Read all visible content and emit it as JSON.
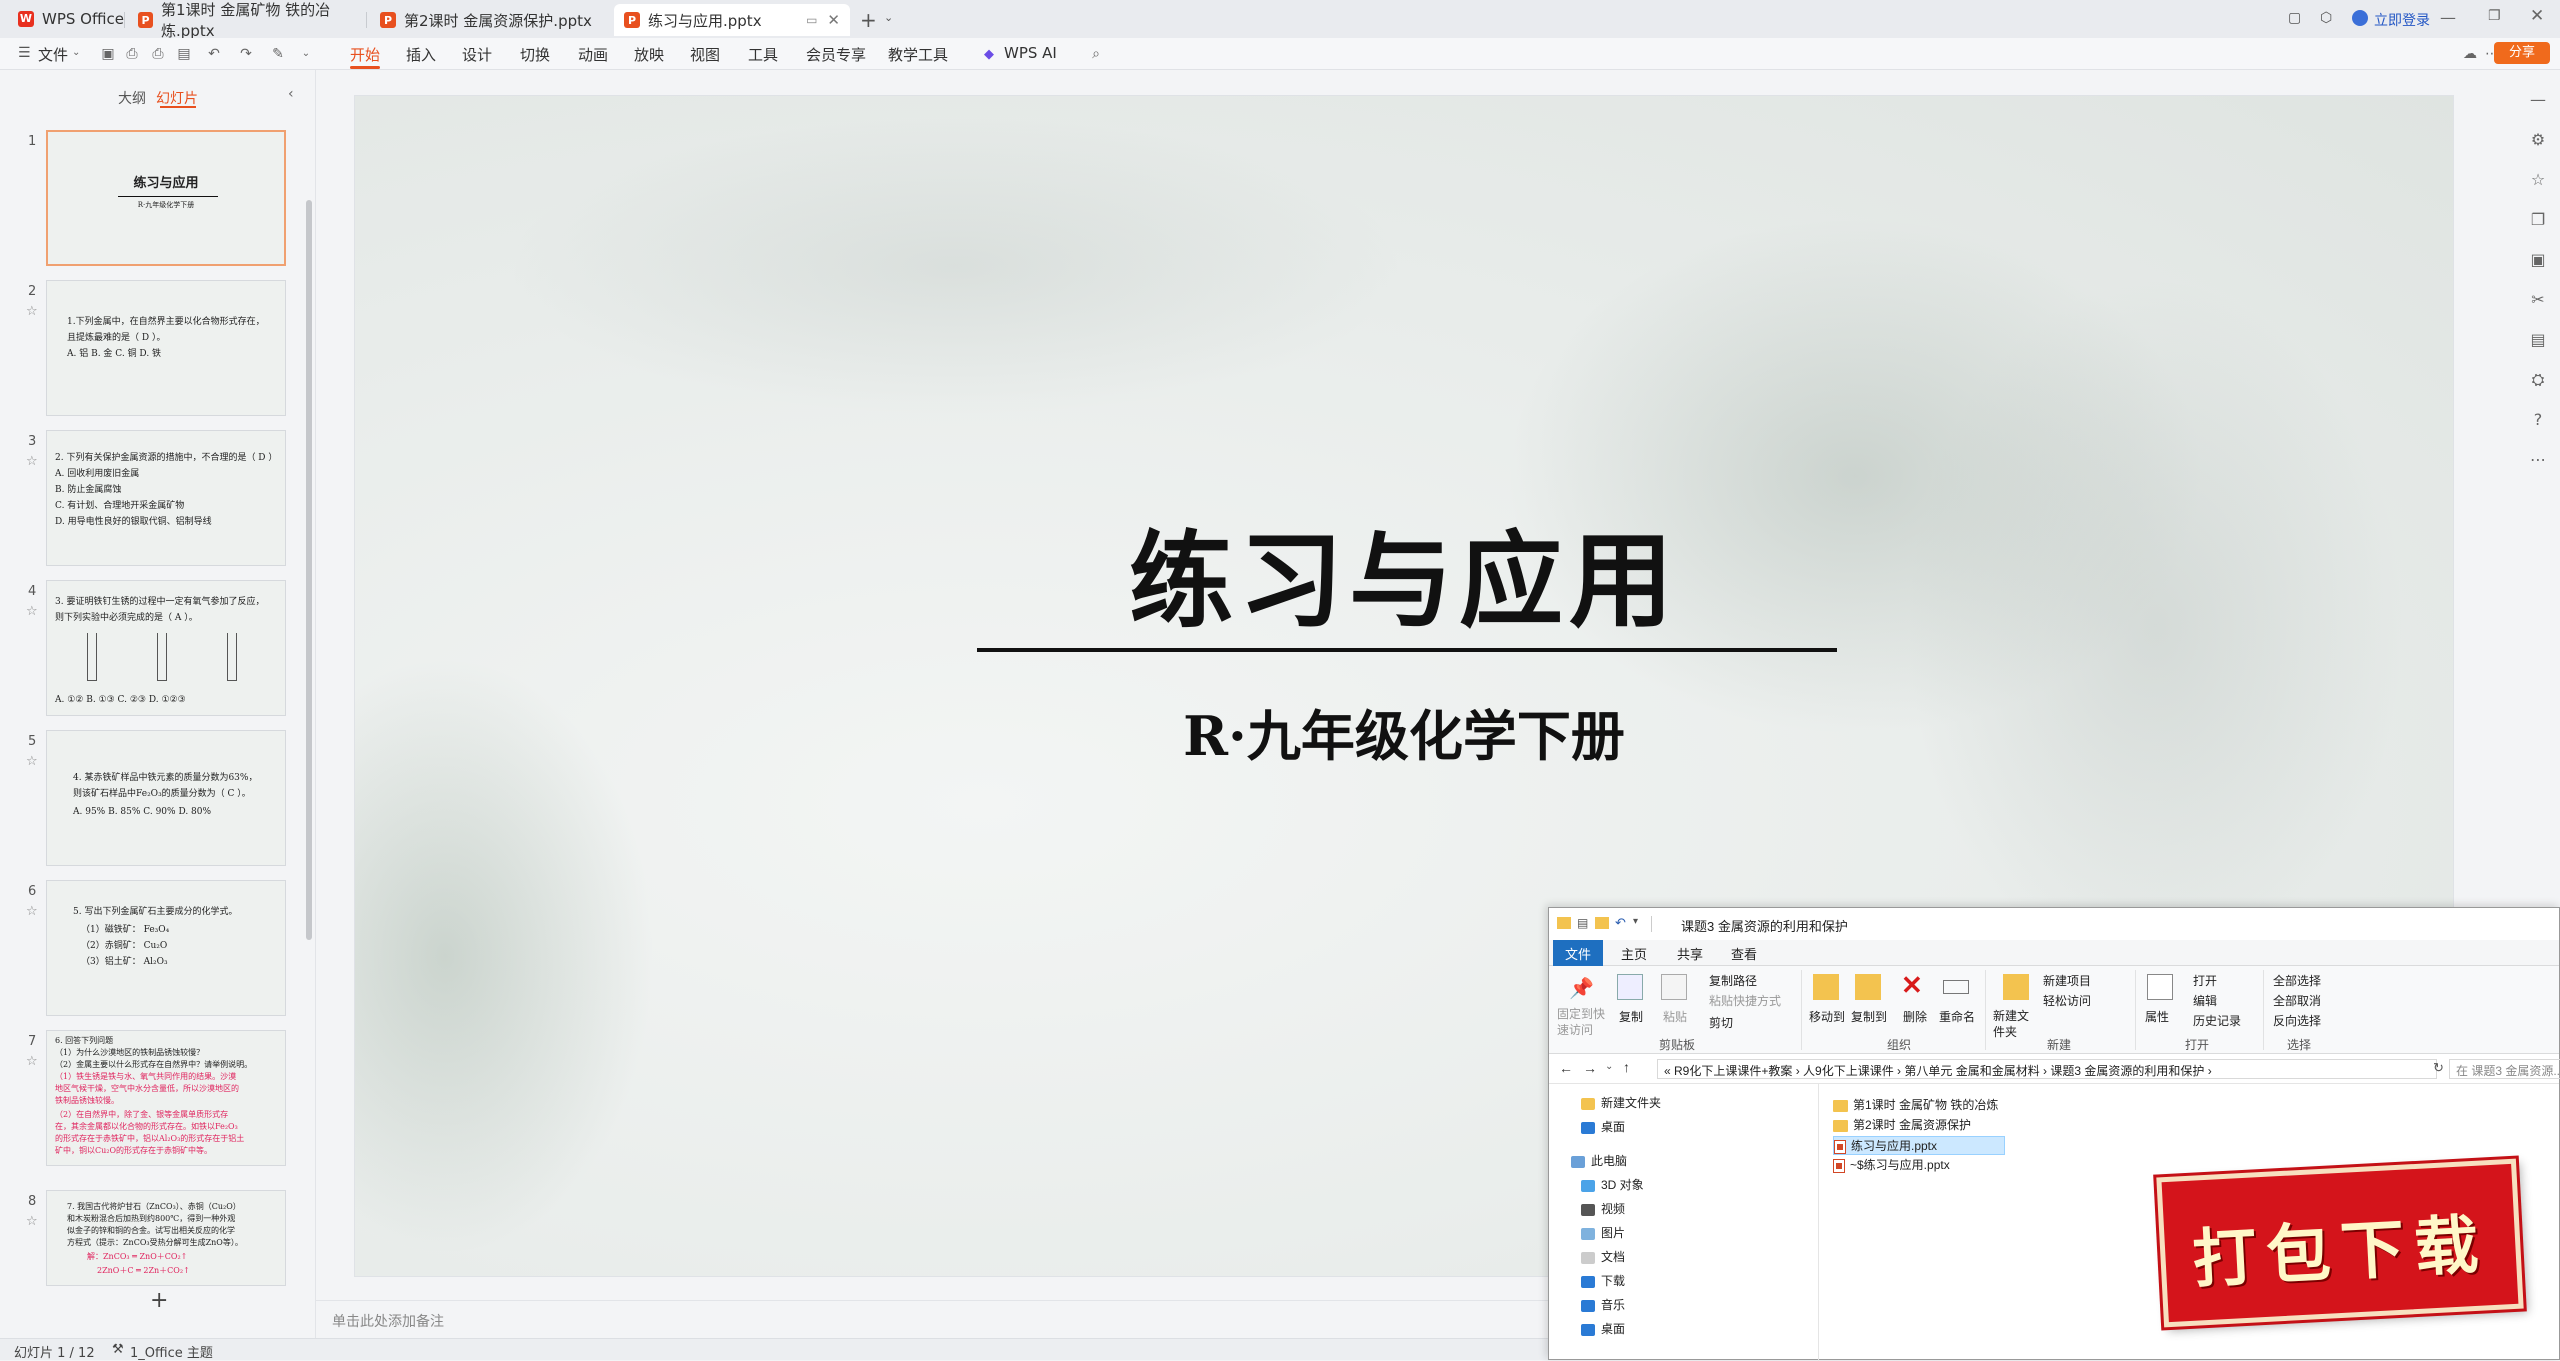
{
  "titlebar": {
    "app_name": "WPS Office",
    "tabs": [
      {
        "label": "第1课时 金属矿物 铁的冶炼.pptx"
      },
      {
        "label": "第2课时 金属资源保护.pptx"
      },
      {
        "label": "练习与应用.pptx",
        "active": true
      }
    ],
    "login": "立即登录"
  },
  "menubar": {
    "file": "文件",
    "items": [
      "开始",
      "插入",
      "设计",
      "切换",
      "动画",
      "放映",
      "视图",
      "工具",
      "会员专享",
      "教学工具",
      "WPS AI"
    ],
    "active": "开始",
    "share": "分享"
  },
  "leftpanel": {
    "tab_outline": "大纲",
    "tab_slides": "幻灯片",
    "thumbs": [
      {
        "num": "1",
        "lines": [
          "练习与应用",
          "R·九年级化学下册"
        ]
      },
      {
        "num": "2",
        "lines": [
          "1.下列金属中，在自然界主要以化合物形式存在，",
          "且提炼最难的是（  D  ）。",
          "A. 铝        B. 金        C. 铜        D. 铁"
        ]
      },
      {
        "num": "3",
        "lines": [
          "2. 下列有关保护金属资源的措施中，不合理的是（ D ）",
          "A. 回收利用废旧金属",
          "B. 防止金属腐蚀",
          "C. 有计划、合理地开采金属矿物",
          "D. 用导电性良好的银取代铜、铝制导线"
        ]
      },
      {
        "num": "4",
        "lines": [
          "3. 要证明铁钉生锈的过程中一定有氧气参加了反应，",
          "则下列实验中必须完成的是（  A  ）。",
          "A. ①②     B. ①③      C. ②③      D. ①②③"
        ]
      },
      {
        "num": "5",
        "lines": [
          "4. 某赤铁矿样品中铁元素的质量分数为63%，",
          "则该矿石样品中Fe₂O₃的质量分数为（  C  ）。",
          "A. 95%     B. 85%     C. 90%     D. 80%"
        ]
      },
      {
        "num": "6",
        "lines": [
          "5. 写出下列金属矿石主要成分的化学式。",
          "（1）磁铁矿：  Fe₃O₄",
          "（2）赤铜矿：  Cu₂O",
          "（3）铝土矿：  Al₂O₃"
        ]
      },
      {
        "num": "7",
        "lines": [
          "6. 回答下列问题",
          "（1）为什么沙漠地区的铁制品锈蚀较慢？",
          "（2）金属主要以什么形式存在自然界中？请举例说明。",
          "（1）铁生锈是铁与水、氧气共同作用的结果。沙漠",
          "地区气候干燥，空气中水分含量低，所以沙漠地区的",
          "铁制品锈蚀较慢。",
          "（2）在自然界中，除了金、银等金属单质形式存",
          "在，其余金属都以化合物的形式存在。如铁以Fe₂O₃",
          "的形式存在于赤铁矿中，铝以Al₂O₃的形式存在于铝土",
          "矿中，铜以Cu₂O的形式存在于赤铜矿中等。"
        ]
      },
      {
        "num": "8",
        "lines": [
          "7. 我国古代将炉甘石（ZnCO₃）、赤铜（Cu₂O）",
          "和木炭粉混合后加热到约800℃，得到一种外观",
          "似金子的锌和铜的合金。试写出相关反应的化学",
          "方程式（提示：ZnCO₃受热分解可生成ZnO等）。",
          "解：ZnCO₃ ═ ZnO＋CO₂↑",
          "2ZnO＋C ═ 2Zn＋CO₂↑"
        ]
      }
    ],
    "add": "+"
  },
  "slide": {
    "title": "练习与应用",
    "subtitle": "R·九年级化学下册"
  },
  "notes": {
    "placeholder": "单击此处添加备注"
  },
  "statusbar": {
    "slide_count": "幻灯片 1 / 12",
    "theme": "1_Office 主题"
  },
  "explorer": {
    "title": "课题3 金属资源的利用和保护",
    "tabs": [
      "文件",
      "主页",
      "共享",
      "查看"
    ],
    "ribbon": {
      "pin": "固定到快速访问",
      "copy": "复制",
      "paste": "粘贴",
      "copy_path": "复制路径",
      "paste_shortcut": "粘贴快捷方式",
      "cut": "剪切",
      "group_clipboard": "剪贴板",
      "move_to": "移动到",
      "copy_to": "复制到",
      "delete": "删除",
      "rename": "重命名",
      "group_organize": "组织",
      "new_folder": "新建文件夹",
      "new_item": "新建项目",
      "easy_access": "轻松访问",
      "group_new": "新建",
      "properties": "属性",
      "open": "打开",
      "edit": "编辑",
      "history": "历史记录",
      "group_open": "打开",
      "select_all": "全部选择",
      "select_none": "全部取消",
      "invert": "反向选择",
      "group_select": "选择"
    },
    "path": "«  R9化下上课课件+教案  ›  人9化下上课课件  ›  第八单元 金属和金属材料  ›  课题3 金属资源的利用和保护  ›",
    "search": "在 课题3 金属资源...",
    "nav": [
      "新建文件夹",
      "桌面",
      "此电脑",
      "3D 对象",
      "视频",
      "图片",
      "文档",
      "下载",
      "音乐",
      "桌面"
    ],
    "files": [
      {
        "name": "第1课时 金属矿物 铁的冶炼",
        "type": "folder"
      },
      {
        "name": "第2课时 金属资源保护",
        "type": "folder"
      },
      {
        "name": "练习与应用.pptx",
        "type": "ppt",
        "selected": true
      },
      {
        "name": "~$练习与应用.pptx",
        "type": "ppt"
      }
    ]
  },
  "download_banner": "打包下载"
}
